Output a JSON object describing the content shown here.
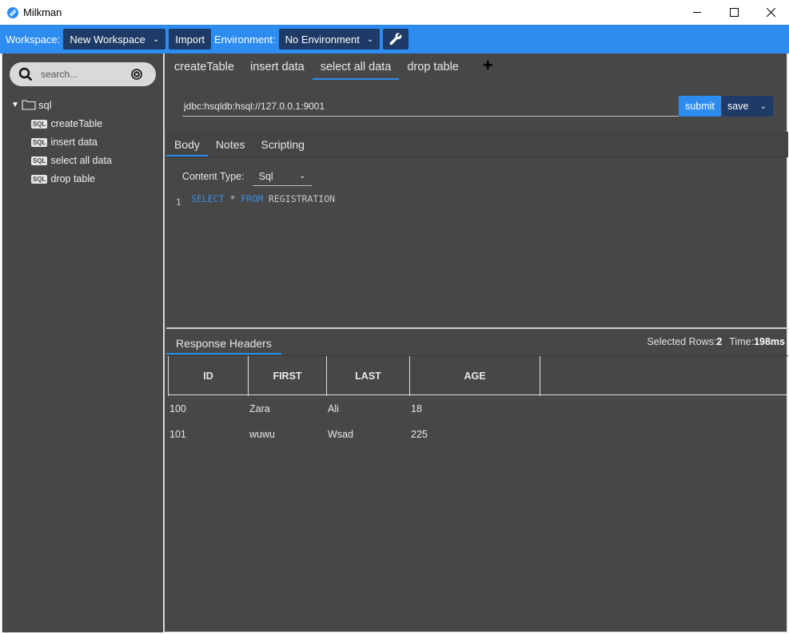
{
  "window": {
    "title": "Milkman"
  },
  "toolbar": {
    "workspace_label": "Workspace:",
    "workspace_value": "New Workspace",
    "import_label": "Import",
    "environment_label": "Environment:",
    "environment_value": "No Environment"
  },
  "sidebar": {
    "search_placeholder": "search...",
    "folder": "sql",
    "items": [
      {
        "badge": "SQL",
        "label": "createTable"
      },
      {
        "badge": "SQL",
        "label": "insert data"
      },
      {
        "badge": "SQL",
        "label": "select all data"
      },
      {
        "badge": "SQL",
        "label": "drop table"
      }
    ]
  },
  "request_tabs": [
    "createTable",
    "insert data",
    "select all data",
    "drop table"
  ],
  "active_request_tab": "select all data",
  "request": {
    "url": "jdbc:hsqldb:hsql://127.0.0.1:9001",
    "submit_label": "submit",
    "save_label": "save"
  },
  "body_tabs": [
    "Body",
    "Notes",
    "Scripting"
  ],
  "content_type": {
    "label": "Content Type:",
    "value": "Sql"
  },
  "editor": {
    "line_number": "1",
    "kw1": "SELECT",
    "star": "*",
    "kw2": "FROM",
    "table": "REGISTRATION"
  },
  "response": {
    "tab": "Response Headers",
    "selected_rows_label": "Selected Rows:",
    "selected_rows_value": "2",
    "time_label": "Time:",
    "time_value": "198ms",
    "columns": [
      "ID",
      "FIRST",
      "LAST",
      "AGE"
    ],
    "rows": [
      [
        "100",
        "Zara",
        "Ali",
        "18"
      ],
      [
        "101",
        "wuwu",
        "Wsad",
        "225"
      ]
    ]
  },
  "colors": {
    "accent": "#2d8cf0",
    "dark_button": "#1e3a66",
    "panel": "#474747"
  }
}
